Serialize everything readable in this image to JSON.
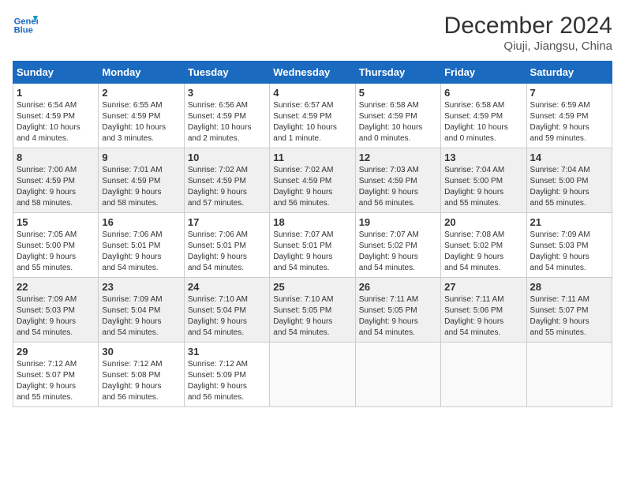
{
  "logo": {
    "line1": "General",
    "line2": "Blue"
  },
  "title": "December 2024",
  "subtitle": "Qiuji, Jiangsu, China",
  "days_of_week": [
    "Sunday",
    "Monday",
    "Tuesday",
    "Wednesday",
    "Thursday",
    "Friday",
    "Saturday"
  ],
  "weeks": [
    [
      {
        "day": 1,
        "info": "Sunrise: 6:54 AM\nSunset: 4:59 PM\nDaylight: 10 hours\nand 4 minutes."
      },
      {
        "day": 2,
        "info": "Sunrise: 6:55 AM\nSunset: 4:59 PM\nDaylight: 10 hours\nand 3 minutes."
      },
      {
        "day": 3,
        "info": "Sunrise: 6:56 AM\nSunset: 4:59 PM\nDaylight: 10 hours\nand 2 minutes."
      },
      {
        "day": 4,
        "info": "Sunrise: 6:57 AM\nSunset: 4:59 PM\nDaylight: 10 hours\nand 1 minute."
      },
      {
        "day": 5,
        "info": "Sunrise: 6:58 AM\nSunset: 4:59 PM\nDaylight: 10 hours\nand 0 minutes."
      },
      {
        "day": 6,
        "info": "Sunrise: 6:58 AM\nSunset: 4:59 PM\nDaylight: 10 hours\nand 0 minutes."
      },
      {
        "day": 7,
        "info": "Sunrise: 6:59 AM\nSunset: 4:59 PM\nDaylight: 9 hours\nand 59 minutes."
      }
    ],
    [
      {
        "day": 8,
        "info": "Sunrise: 7:00 AM\nSunset: 4:59 PM\nDaylight: 9 hours\nand 58 minutes."
      },
      {
        "day": 9,
        "info": "Sunrise: 7:01 AM\nSunset: 4:59 PM\nDaylight: 9 hours\nand 58 minutes."
      },
      {
        "day": 10,
        "info": "Sunrise: 7:02 AM\nSunset: 4:59 PM\nDaylight: 9 hours\nand 57 minutes."
      },
      {
        "day": 11,
        "info": "Sunrise: 7:02 AM\nSunset: 4:59 PM\nDaylight: 9 hours\nand 56 minutes."
      },
      {
        "day": 12,
        "info": "Sunrise: 7:03 AM\nSunset: 4:59 PM\nDaylight: 9 hours\nand 56 minutes."
      },
      {
        "day": 13,
        "info": "Sunrise: 7:04 AM\nSunset: 5:00 PM\nDaylight: 9 hours\nand 55 minutes."
      },
      {
        "day": 14,
        "info": "Sunrise: 7:04 AM\nSunset: 5:00 PM\nDaylight: 9 hours\nand 55 minutes."
      }
    ],
    [
      {
        "day": 15,
        "info": "Sunrise: 7:05 AM\nSunset: 5:00 PM\nDaylight: 9 hours\nand 55 minutes."
      },
      {
        "day": 16,
        "info": "Sunrise: 7:06 AM\nSunset: 5:01 PM\nDaylight: 9 hours\nand 54 minutes."
      },
      {
        "day": 17,
        "info": "Sunrise: 7:06 AM\nSunset: 5:01 PM\nDaylight: 9 hours\nand 54 minutes."
      },
      {
        "day": 18,
        "info": "Sunrise: 7:07 AM\nSunset: 5:01 PM\nDaylight: 9 hours\nand 54 minutes."
      },
      {
        "day": 19,
        "info": "Sunrise: 7:07 AM\nSunset: 5:02 PM\nDaylight: 9 hours\nand 54 minutes."
      },
      {
        "day": 20,
        "info": "Sunrise: 7:08 AM\nSunset: 5:02 PM\nDaylight: 9 hours\nand 54 minutes."
      },
      {
        "day": 21,
        "info": "Sunrise: 7:09 AM\nSunset: 5:03 PM\nDaylight: 9 hours\nand 54 minutes."
      }
    ],
    [
      {
        "day": 22,
        "info": "Sunrise: 7:09 AM\nSunset: 5:03 PM\nDaylight: 9 hours\nand 54 minutes."
      },
      {
        "day": 23,
        "info": "Sunrise: 7:09 AM\nSunset: 5:04 PM\nDaylight: 9 hours\nand 54 minutes."
      },
      {
        "day": 24,
        "info": "Sunrise: 7:10 AM\nSunset: 5:04 PM\nDaylight: 9 hours\nand 54 minutes."
      },
      {
        "day": 25,
        "info": "Sunrise: 7:10 AM\nSunset: 5:05 PM\nDaylight: 9 hours\nand 54 minutes."
      },
      {
        "day": 26,
        "info": "Sunrise: 7:11 AM\nSunset: 5:05 PM\nDaylight: 9 hours\nand 54 minutes."
      },
      {
        "day": 27,
        "info": "Sunrise: 7:11 AM\nSunset: 5:06 PM\nDaylight: 9 hours\nand 54 minutes."
      },
      {
        "day": 28,
        "info": "Sunrise: 7:11 AM\nSunset: 5:07 PM\nDaylight: 9 hours\nand 55 minutes."
      }
    ],
    [
      {
        "day": 29,
        "info": "Sunrise: 7:12 AM\nSunset: 5:07 PM\nDaylight: 9 hours\nand 55 minutes."
      },
      {
        "day": 30,
        "info": "Sunrise: 7:12 AM\nSunset: 5:08 PM\nDaylight: 9 hours\nand 56 minutes."
      },
      {
        "day": 31,
        "info": "Sunrise: 7:12 AM\nSunset: 5:09 PM\nDaylight: 9 hours\nand 56 minutes."
      },
      null,
      null,
      null,
      null
    ]
  ]
}
